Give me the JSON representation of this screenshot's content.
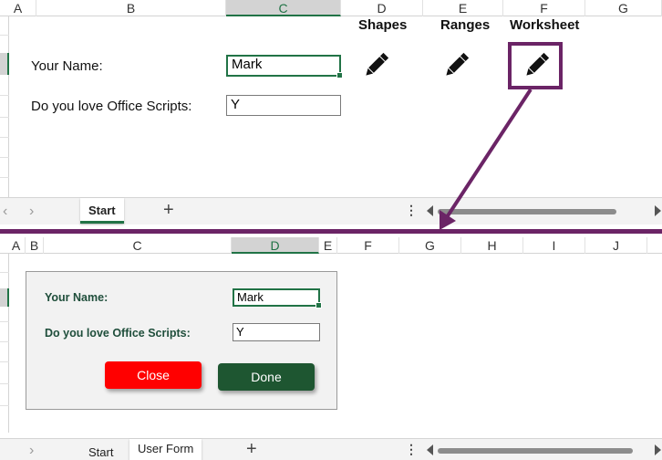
{
  "top_sheet": {
    "columns": [
      "A",
      "B",
      "C",
      "D",
      "E",
      "F",
      "G"
    ],
    "header_labels": {
      "shapes": "Shapes",
      "ranges": "Ranges",
      "worksheet": "Worksheet"
    },
    "name_label": "Your Name:",
    "name_value": "Mark",
    "love_label": "Do you love Office Scripts:",
    "love_value": "Y",
    "tabs": [
      {
        "label": "Start",
        "active": true
      }
    ],
    "add_sheet": "+",
    "more": "⋮"
  },
  "bottom_sheet": {
    "columns": [
      "A",
      "B",
      "C",
      "D",
      "E",
      "F",
      "G",
      "H",
      "I",
      "J"
    ],
    "form": {
      "name_label": "Your Name:",
      "name_value": "Mark",
      "love_label": "Do you love Office Scripts:",
      "love_value": "Y",
      "close_label": "Close",
      "done_label": "Done"
    },
    "tabs": [
      {
        "label": "Start",
        "active": false
      },
      {
        "label": "User Form",
        "active": true
      }
    ],
    "add_sheet": "+",
    "more": "⋮"
  },
  "icons": {
    "pencil": "pencil-icon",
    "nav_prev": "chevron-left-icon",
    "nav_next": "chevron-right-icon"
  },
  "colors": {
    "excel_green": "#217346",
    "highlight_purple": "#6b2466",
    "close_red": "#ff0000",
    "done_green": "#1e5631",
    "form_label": "#1f4e3b"
  }
}
